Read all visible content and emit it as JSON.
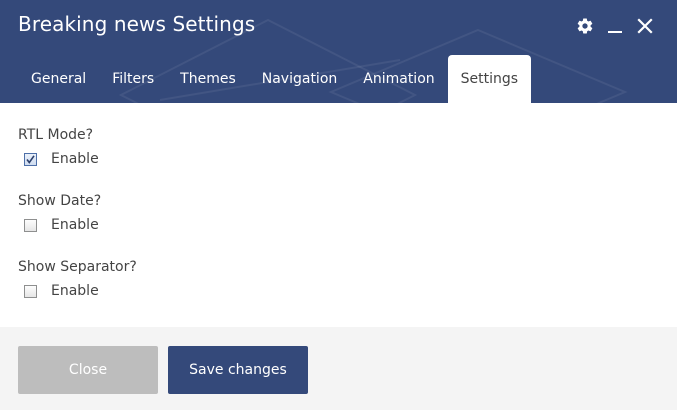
{
  "dialog": {
    "title": "Breaking news Settings",
    "header_icons": [
      "gear-icon",
      "minimize-icon",
      "close-icon"
    ]
  },
  "tabs": [
    {
      "label": "General",
      "active": false
    },
    {
      "label": "Filters",
      "active": false
    },
    {
      "label": "Themes",
      "active": false
    },
    {
      "label": "Navigation",
      "active": false
    },
    {
      "label": "Animation",
      "active": false
    },
    {
      "label": "Settings",
      "active": true
    }
  ],
  "settings": [
    {
      "label": "RTL Mode?",
      "option_label": "Enable",
      "checked": true
    },
    {
      "label": "Show Date?",
      "option_label": "Enable",
      "checked": false
    },
    {
      "label": "Show Separator?",
      "option_label": "Enable",
      "checked": false
    }
  ],
  "footer": {
    "close_label": "Close",
    "save_label": "Save changes"
  },
  "colors": {
    "header_bg": "#34497a",
    "primary_button": "#34497a",
    "disabled_button": "#bdbdbd",
    "footer_bg": "#f4f4f4"
  }
}
